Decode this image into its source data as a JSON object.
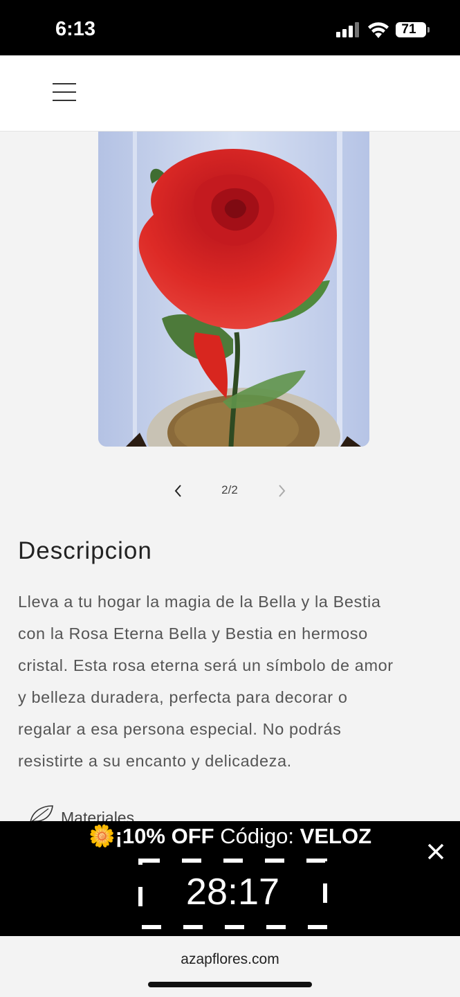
{
  "status_bar": {
    "time": "6:13",
    "battery": "71",
    "icons": [
      "signal-icon",
      "wifi-icon",
      "battery-icon"
    ]
  },
  "header": {
    "menu_icon": "hamburger-menu-icon"
  },
  "product": {
    "image_description_icon": "rose-in-glass-dome-image",
    "pager": {
      "current_label": "2/2",
      "prev_icon": "chevron-left-icon",
      "next_icon": "chevron-right-icon"
    }
  },
  "description": {
    "title": "Descripcion",
    "lines": [
      "Lleva a tu hogar la magia de la Bella y la Bestia",
      "con la Rosa Eterna Bella y Bestia en hermoso",
      "cristal. Esta rosa eterna será un símbolo de amor",
      "y belleza duradera, perfecta para decorar o",
      "regalar a esa persona especial. No podrás",
      "resistirte a su encanto y delicadeza."
    ],
    "material_label": "Materiales"
  },
  "promo": {
    "emoji": "🌼",
    "offer": "¡10% OFF",
    "code_label": "Código:",
    "code": "VELOZ",
    "timer": "28:17",
    "close_icon": "close-icon"
  },
  "browser": {
    "url": "azapflores.com"
  },
  "colors": {
    "promo_bg": "#000000",
    "page_bg": "#f3f3f3",
    "rose_red": "#d81e1e"
  }
}
